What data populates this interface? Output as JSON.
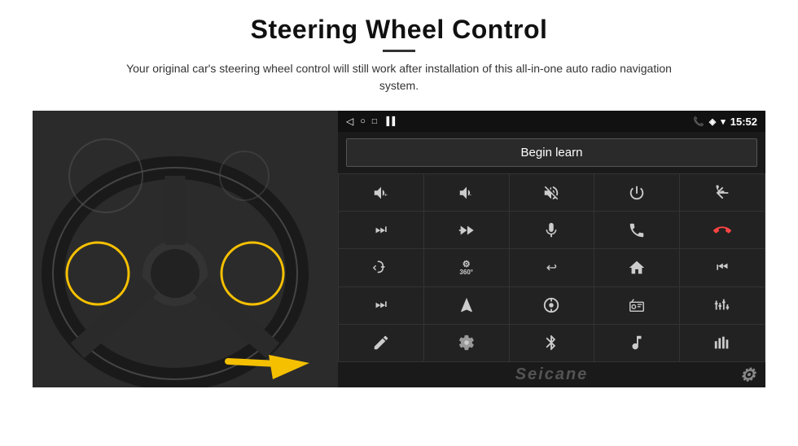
{
  "header": {
    "title": "Steering Wheel Control",
    "subtitle": "Your original car's steering wheel control will still work after installation of this all-in-one auto radio navigation system."
  },
  "status_bar": {
    "left_icons": [
      "◁",
      "○",
      "□",
      "📶"
    ],
    "time": "15:52",
    "right_icons": [
      "📞",
      "📍",
      "📶"
    ]
  },
  "begin_learn_button": "Begin learn",
  "controls": [
    {
      "icon": "vol+",
      "unicode": "🔊+",
      "label": "Volume Up"
    },
    {
      "icon": "vol-",
      "unicode": "🔉-",
      "label": "Volume Down"
    },
    {
      "icon": "mute",
      "unicode": "🔇",
      "label": "Mute"
    },
    {
      "icon": "power",
      "unicode": "⏻",
      "label": "Power"
    },
    {
      "icon": "prev-track",
      "unicode": "⏮",
      "label": "Previous Track"
    },
    {
      "icon": "skip-next",
      "unicode": "⏭",
      "label": "Skip Next"
    },
    {
      "icon": "ffwd",
      "unicode": "⏩",
      "label": "Fast Forward"
    },
    {
      "icon": "mic",
      "unicode": "🎤",
      "label": "Microphone"
    },
    {
      "icon": "phone",
      "unicode": "📞",
      "label": "Phone"
    },
    {
      "icon": "hang-up",
      "unicode": "📵",
      "label": "Hang Up"
    },
    {
      "icon": "horn",
      "unicode": "📢",
      "label": "Horn"
    },
    {
      "icon": "360",
      "unicode": "360°",
      "label": "360 View"
    },
    {
      "icon": "back",
      "unicode": "↩",
      "label": "Back"
    },
    {
      "icon": "home",
      "unicode": "⌂",
      "label": "Home"
    },
    {
      "icon": "skip-back",
      "unicode": "⏮",
      "label": "Skip Back"
    },
    {
      "icon": "skip-fwd2",
      "unicode": "⏭",
      "label": "Skip Forward"
    },
    {
      "icon": "nav",
      "unicode": "➤",
      "label": "Navigation"
    },
    {
      "icon": "eject",
      "unicode": "⏏",
      "label": "Eject/Source"
    },
    {
      "icon": "radio",
      "unicode": "📻",
      "label": "Radio"
    },
    {
      "icon": "equalizer",
      "unicode": "🎛",
      "label": "Equalizer"
    },
    {
      "icon": "pen",
      "unicode": "✏",
      "label": "Pen/Edit"
    },
    {
      "icon": "settings2",
      "unicode": "⚙",
      "label": "Settings"
    },
    {
      "icon": "bluetooth",
      "unicode": "✦",
      "label": "Bluetooth"
    },
    {
      "icon": "music",
      "unicode": "♫",
      "label": "Music"
    },
    {
      "icon": "wave",
      "unicode": "|||",
      "label": "Audio Levels"
    }
  ],
  "watermark": "Seicane",
  "colors": {
    "background": "#ffffff",
    "head_unit_bg": "#1a1a1a",
    "button_bg": "#222222",
    "button_border": "#333333",
    "text": "#cccccc",
    "accent_yellow": "#f5c000"
  }
}
